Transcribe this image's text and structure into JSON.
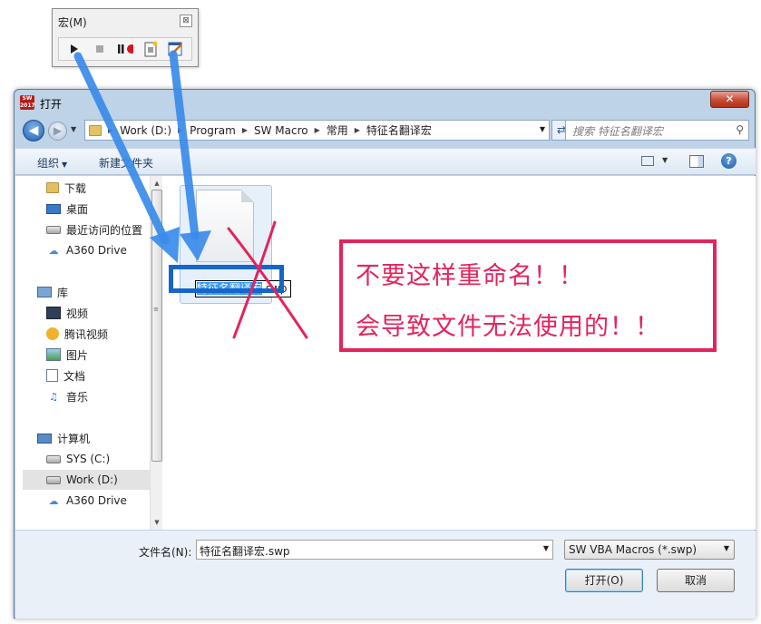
{
  "macro_toolbar": {
    "title": "宏(M)",
    "close_glyph": "⊠",
    "buttons": [
      "run-icon",
      "stop-icon",
      "pause-record-icon",
      "new-macro-icon",
      "edit-macro-icon"
    ]
  },
  "dialog": {
    "title": "打开",
    "close_glyph": "✕",
    "app_icon_text": "SW 2017"
  },
  "address": {
    "crumbs": [
      "Work (D:)",
      "Program",
      "SW Macro",
      "常用",
      "特征名翻译宏"
    ],
    "search_placeholder": "搜索 特征名翻译宏"
  },
  "toolbar": {
    "organize": "组织",
    "new_folder": "新建文件夹",
    "help_glyph": "?"
  },
  "nav": {
    "items": [
      {
        "label": "下载",
        "icon": "downloads-folder-icon"
      },
      {
        "label": "桌面",
        "icon": "desktop-icon"
      },
      {
        "label": "最近访问的位置",
        "icon": "recent-places-icon"
      },
      {
        "label": "A360 Drive",
        "icon": "a360-drive-icon"
      },
      {
        "label": "库",
        "icon": "library-icon"
      },
      {
        "label": "视频",
        "icon": "videos-icon"
      },
      {
        "label": "腾讯视频",
        "icon": "tencent-video-icon"
      },
      {
        "label": "图片",
        "icon": "pictures-icon"
      },
      {
        "label": "文档",
        "icon": "documents-icon"
      },
      {
        "label": "音乐",
        "icon": "music-icon"
      },
      {
        "label": "计算机",
        "icon": "computer-icon"
      },
      {
        "label": "SYS (C:)",
        "icon": "drive-c-icon"
      },
      {
        "label": "Work (D:)",
        "icon": "drive-d-icon"
      },
      {
        "label": "A360 Drive",
        "icon": "a360-drive-icon"
      }
    ]
  },
  "file": {
    "rename_selected": "特征名翻译宏",
    "rename_rest": ".swp"
  },
  "bottom": {
    "filename_label": "文件名(N):",
    "filename_value": "特征名翻译宏.swp",
    "filter_value": "SW VBA Macros (*.swp)",
    "open_label": "打开(O)",
    "cancel_label": "取消"
  },
  "annotation": {
    "line1": "不要这样重命名！！",
    "line2": "会导致文件无法使用的！！",
    "color": "#e3245c",
    "arrow_color": "#3a8bea"
  }
}
